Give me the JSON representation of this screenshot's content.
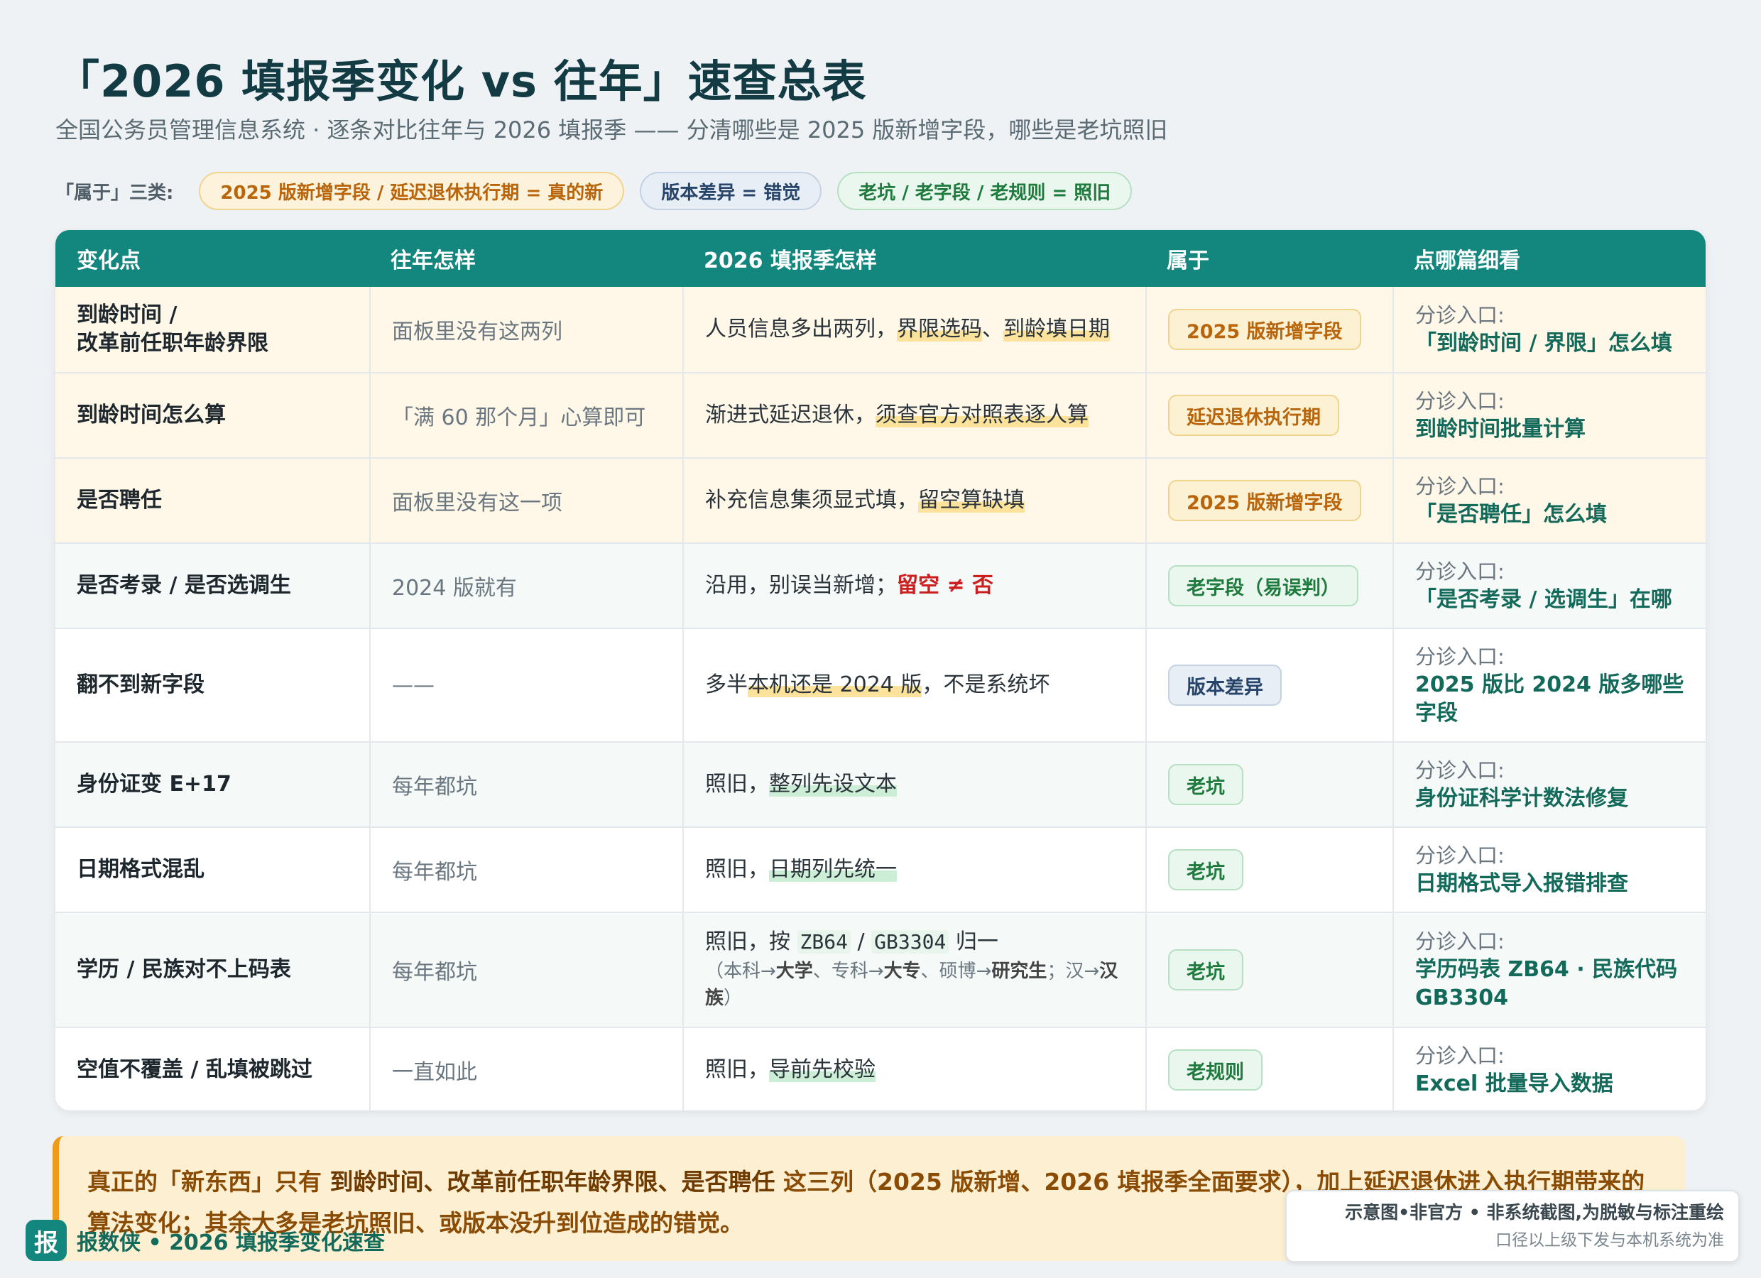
{
  "title": "「2026 填报季变化 vs 往年」速查总表",
  "subtitle": "全国公务员管理信息系统 · 逐条对比往年与 2026 填报季 —— 分清哪些是 2025 版新增字段，哪些是老坑照旧",
  "legend": {
    "label": "「属于」三类:",
    "new": "2025 版新增字段 / 延迟退休执行期 = 真的新",
    "diff": "版本差异 = 错觉",
    "old": "老坑 / 老字段 / 老规则 = 照旧"
  },
  "table": {
    "headers": [
      "变化点",
      "往年怎样",
      "2026 填报季怎样",
      "属于",
      "点哪篇细看"
    ],
    "entry_label": "分诊入口:",
    "rows": [
      {
        "name_line1": "到龄时间 /",
        "name_line2": "改革前任职年龄界限",
        "prev": "面板里没有这两列",
        "now_a": "人员信息多出两列，",
        "now_hl1": "界限选码",
        "now_sep": "、",
        "now_hl2": "到龄填日期",
        "tag": "2025 版新增字段",
        "link": "「到龄时间 / 界限」怎么填"
      },
      {
        "name": "到龄时间怎么算",
        "prev": "「满 60 那个月」心算即可",
        "now_a": "渐进式延迟退休，",
        "now_hl": "须查官方对照表逐人算",
        "tag": "延迟退休执行期",
        "link": "到龄时间批量计算"
      },
      {
        "name": "是否聘任",
        "prev": "面板里没有这一项",
        "now_a": "补充信息集须显式填，",
        "now_hl": "留空算缺填",
        "tag": "2025 版新增字段",
        "link": "「是否聘任」怎么填"
      },
      {
        "name": "是否考录 / 是否选调生",
        "prev": "2024 版就有",
        "now_a": "沿用，别误当新增；",
        "now_red": "留空 ≠ 否",
        "tag": "老字段（易误判）",
        "link": "「是否考录 / 选调生」在哪"
      },
      {
        "name": "翻不到新字段",
        "prev": "——",
        "now_a": "多半",
        "now_hl": "本机还是 2024 版",
        "now_b": "，不是系统坏",
        "tag": "版本差异",
        "link_line1": "2025 版比 2024 版多哪些",
        "link_line2": "字段"
      },
      {
        "name": "身份证变 E+17",
        "prev": "每年都坑",
        "now_a": "照旧，",
        "now_hl": "整列先设文本",
        "tag": "老坑",
        "link": "身份证科学计数法修复"
      },
      {
        "name": "日期格式混乱",
        "prev": "每年都坑",
        "now_a": "照旧，",
        "now_hl": "日期列先统一",
        "tag": "老坑",
        "link": "日期格式导入报错排查"
      },
      {
        "name": "学历 / 民族对不上码表",
        "prev": "每年都坑",
        "now_a": "照旧，按 ",
        "code1": "ZB64",
        "now_slash": " / ",
        "code2": "GB3304",
        "now_b": " 归一",
        "note_1": "（本科→",
        "note_b1": "大学",
        "note_2": "、专科→",
        "note_b2": "大专",
        "note_3": "、硕博→",
        "note_b3": "研究生",
        "note_4": "；汉→",
        "note_b4": "汉族",
        "note_5": "）",
        "tag": "老坑",
        "link_line1": "学历码表 ZB64 · 民族代码",
        "link_line2": "GB3304"
      },
      {
        "name": "空值不覆盖 / 乱填被跳过",
        "prev": "一直如此",
        "now_a": "照旧，",
        "now_hl": "导前先校验",
        "tag": "老规则",
        "link": "Excel 批量导入数据"
      }
    ]
  },
  "callout": {
    "p1": "真正的「新东西」只有 ",
    "p2": "到龄时间、改革前任职年龄界限、是否聘任",
    "p3": " 这三列（2025 版新增、2026 填报季全面要求），加上延迟退休进入执行期带来的算法变化；其余大多是老坑照旧、或版本没升到位造成的错觉。"
  },
  "brand": {
    "badge": "报",
    "text": "报数侠 • 2026 填报季变化速查"
  },
  "disclaimer": {
    "line1": "示意图•非官方 • 非系统截图,为脱敏与标注重绘",
    "line2": "口径以上级下发与本机系统为准"
  },
  "colors": {
    "header_teal": "#13867e",
    "new_orange": "#b8650b",
    "old_green": "#1f7a3d",
    "diff_blue": "#27456a",
    "alert_red": "#cc1f1f"
  }
}
